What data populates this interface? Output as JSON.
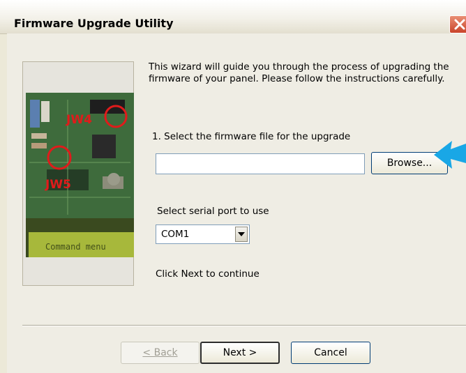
{
  "window": {
    "title": "Firmware Upgrade Utility",
    "close_icon": "close-icon"
  },
  "picture": {
    "labels": [
      "JW4",
      "JW5"
    ],
    "lcd_text": "Command menu"
  },
  "content": {
    "intro": "This wizard will guide you through the process of upgrading the firmware of your panel. Please follow the instructions carefully.",
    "step1_label": "1. Select the firmware file for the upgrade",
    "file_path_value": "",
    "browse_label": "Browse...",
    "serial_label": "Select serial port to use",
    "serial_port_selected": "COM1",
    "continue_text": "Click Next to continue"
  },
  "buttons": {
    "back_label": "< Back",
    "next_label": "Next >",
    "cancel_label": "Cancel"
  },
  "colors": {
    "dialog_bg": "#efede4",
    "arrow": "#19a7e6",
    "close_button": "#d0523a"
  }
}
